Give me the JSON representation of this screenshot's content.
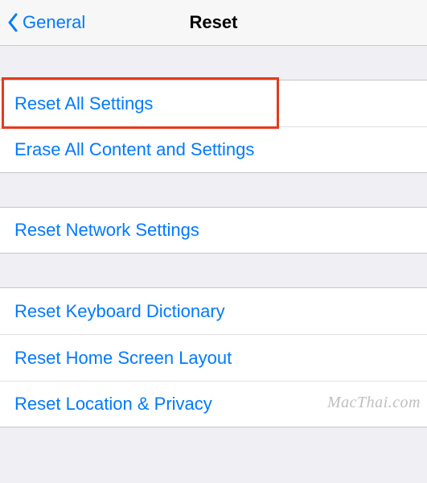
{
  "nav": {
    "back_label": "General",
    "title": "Reset"
  },
  "groups": [
    {
      "items": [
        {
          "label": "Reset All Settings"
        },
        {
          "label": "Erase All Content and Settings"
        }
      ]
    },
    {
      "items": [
        {
          "label": "Reset Network Settings"
        }
      ]
    },
    {
      "items": [
        {
          "label": "Reset Keyboard Dictionary"
        },
        {
          "label": "Reset Home Screen Layout"
        },
        {
          "label": "Reset Location & Privacy"
        }
      ]
    }
  ],
  "watermark": "MacThai.com"
}
